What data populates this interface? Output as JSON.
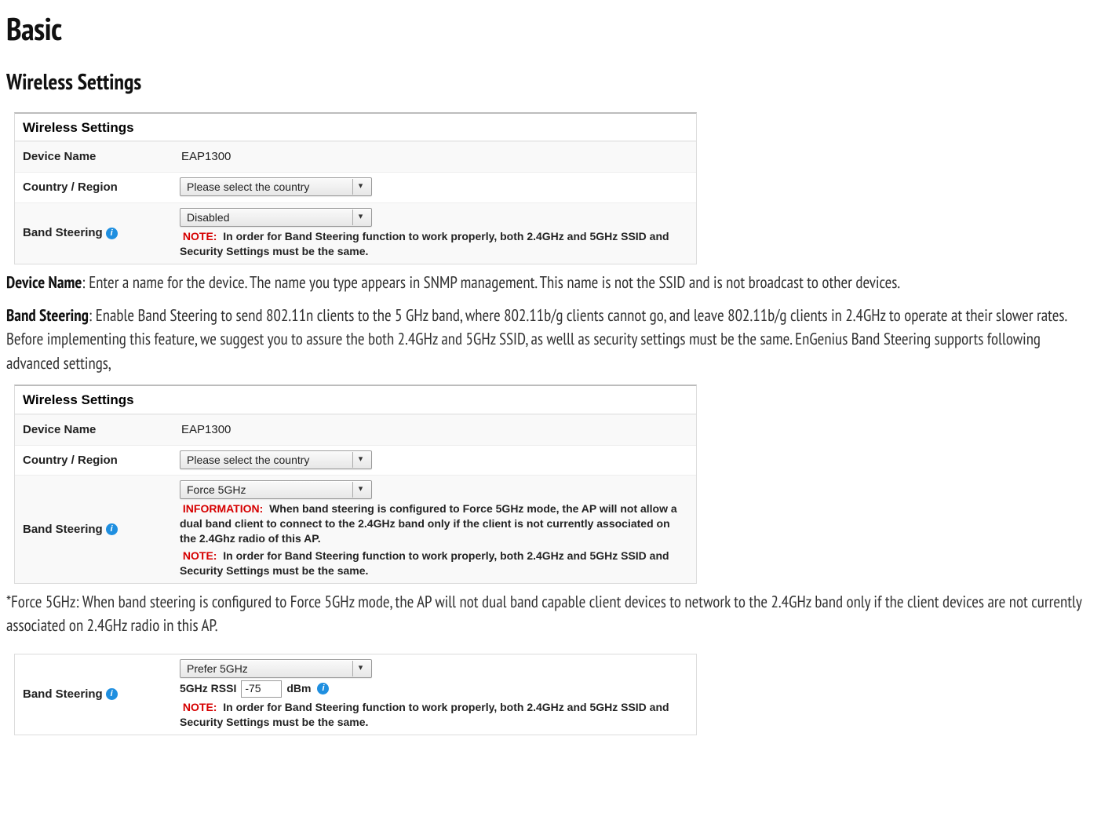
{
  "page": {
    "title": "Basic",
    "section": "Wireless Settings"
  },
  "labels": {
    "wireless_settings": "Wireless Settings",
    "device_name": "Device Name",
    "country_region": "Country / Region",
    "band_steering": "Band Steering",
    "rssi_label": "5GHz RSSI",
    "dbm": "dBm"
  },
  "values": {
    "device_name": "EAP1300",
    "country_placeholder": "Please select the country",
    "bs_disabled": "Disabled",
    "bs_force": "Force 5GHz",
    "bs_prefer": "Prefer 5GHz",
    "rssi_value": "-75"
  },
  "notes": {
    "note_label": "NOTE:",
    "info_label": "INFORMATION:",
    "bs_note": "In order for Band Steering function to work properly, both 2.4GHz and 5GHz SSID and Security Settings must be the same.",
    "bs_info_force": "When band steering is configured to Force 5GHz mode, the AP will not allow a dual band client to connect to the 2.4GHz band only if the client is not currently associated on the 2.4Ghz radio of this AP."
  },
  "paras": {
    "device_name_label": "Device Name",
    "device_name_text": ": Enter a name for the device. The name you type appears in SNMP management. This name is not the SSID and is not broadcast to other devices.",
    "band_steering_label": "Band Steering",
    "band_steering_text": ": Enable Band Steering to send 802.11n clients to the 5 GHz band, where 802.11b/g clients cannot go, and leave 802.11b/g clients in 2.4GHz to operate at their slower rates. Before implementing this feature, we suggest you to assure the both 2.4GHz and 5GHz SSID, as welll as security settings must be the same. EnGenius Band Steering supports following advanced settings,",
    "force_para": "*Force 5GHz: When band steering is configured to Force 5GHz mode, the AP will not dual band capable client devices to network to the 2.4GHz band only if the client devices are not currently associated on 2.4GHz radio in this AP."
  }
}
